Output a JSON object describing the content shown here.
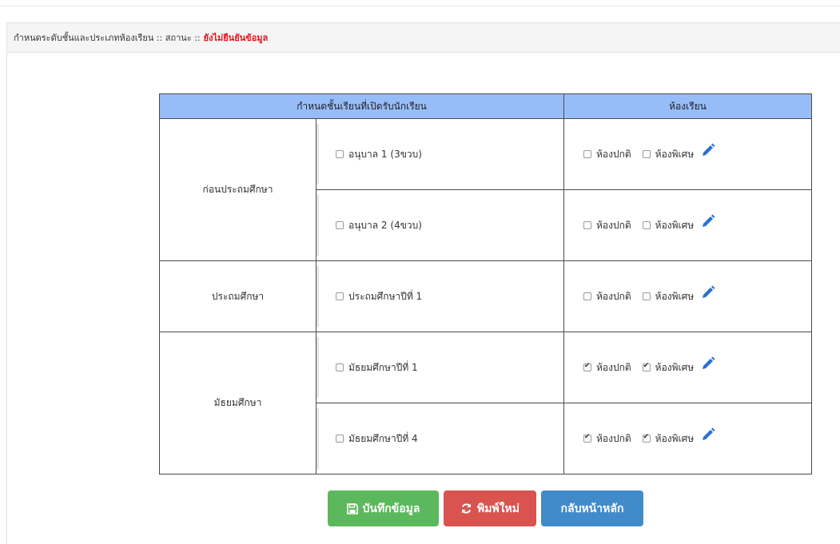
{
  "header": {
    "title": "กำหนดระดับชั้นและประเภทห้องเรียน :: สถานะ ::",
    "status": "ยังไม่ยืนยันข้อมูล",
    "status_color": "#e8101a"
  },
  "table": {
    "columns": [
      "กำหนดชั้นเรียนที่เปิดรับนักเรียน",
      "ห้องเรียน"
    ],
    "header_color": "#97bdf9",
    "groups": [
      {
        "name": "ก่อนประถมศึกษา",
        "levels": [
          {
            "label": "อนุบาล 1 (3ขวบ)",
            "checked": false,
            "normal_room": {
              "label": "ห้องปกติ",
              "checked": false
            },
            "special_room": {
              "label": "ห้องพิเศษ",
              "checked": false
            }
          },
          {
            "label": "อนุบาล 2 (4ขวบ)",
            "checked": false,
            "normal_room": {
              "label": "ห้องปกติ",
              "checked": false
            },
            "special_room": {
              "label": "ห้องพิเศษ",
              "checked": false
            }
          }
        ]
      },
      {
        "name": "ประถมศึกษา",
        "levels": [
          {
            "label": "ประถมศึกษาปีที่ 1",
            "checked": false,
            "normal_room": {
              "label": "ห้องปกติ",
              "checked": false
            },
            "special_room": {
              "label": "ห้องพิเศษ",
              "checked": false
            }
          }
        ]
      },
      {
        "name": "มัธยมศึกษา",
        "levels": [
          {
            "label": "มัธยมศึกษาปีที่ 1",
            "checked": false,
            "normal_room": {
              "label": "ห้องปกติ",
              "checked": true
            },
            "special_room": {
              "label": "ห้องพิเศษ",
              "checked": true
            }
          },
          {
            "label": "มัธยมศึกษาปีที่ 4",
            "checked": false,
            "normal_room": {
              "label": "ห้องปกติ",
              "checked": true
            },
            "special_room": {
              "label": "ห้องพิเศษ",
              "checked": true
            }
          }
        ]
      }
    ]
  },
  "buttons": {
    "save": {
      "label": "บันทึกข้อมูล",
      "icon": "floppy-disk-icon",
      "color": "#5cb85c"
    },
    "reset": {
      "label": "พิมพ์ใหม่",
      "icon": "refresh-icon",
      "color": "#d9534f"
    },
    "back": {
      "label": "กลับหน้าหลัก",
      "color": "#428bca"
    }
  },
  "icons": {
    "edit": "pencil-icon",
    "edit_color": "#2a6fd6"
  }
}
